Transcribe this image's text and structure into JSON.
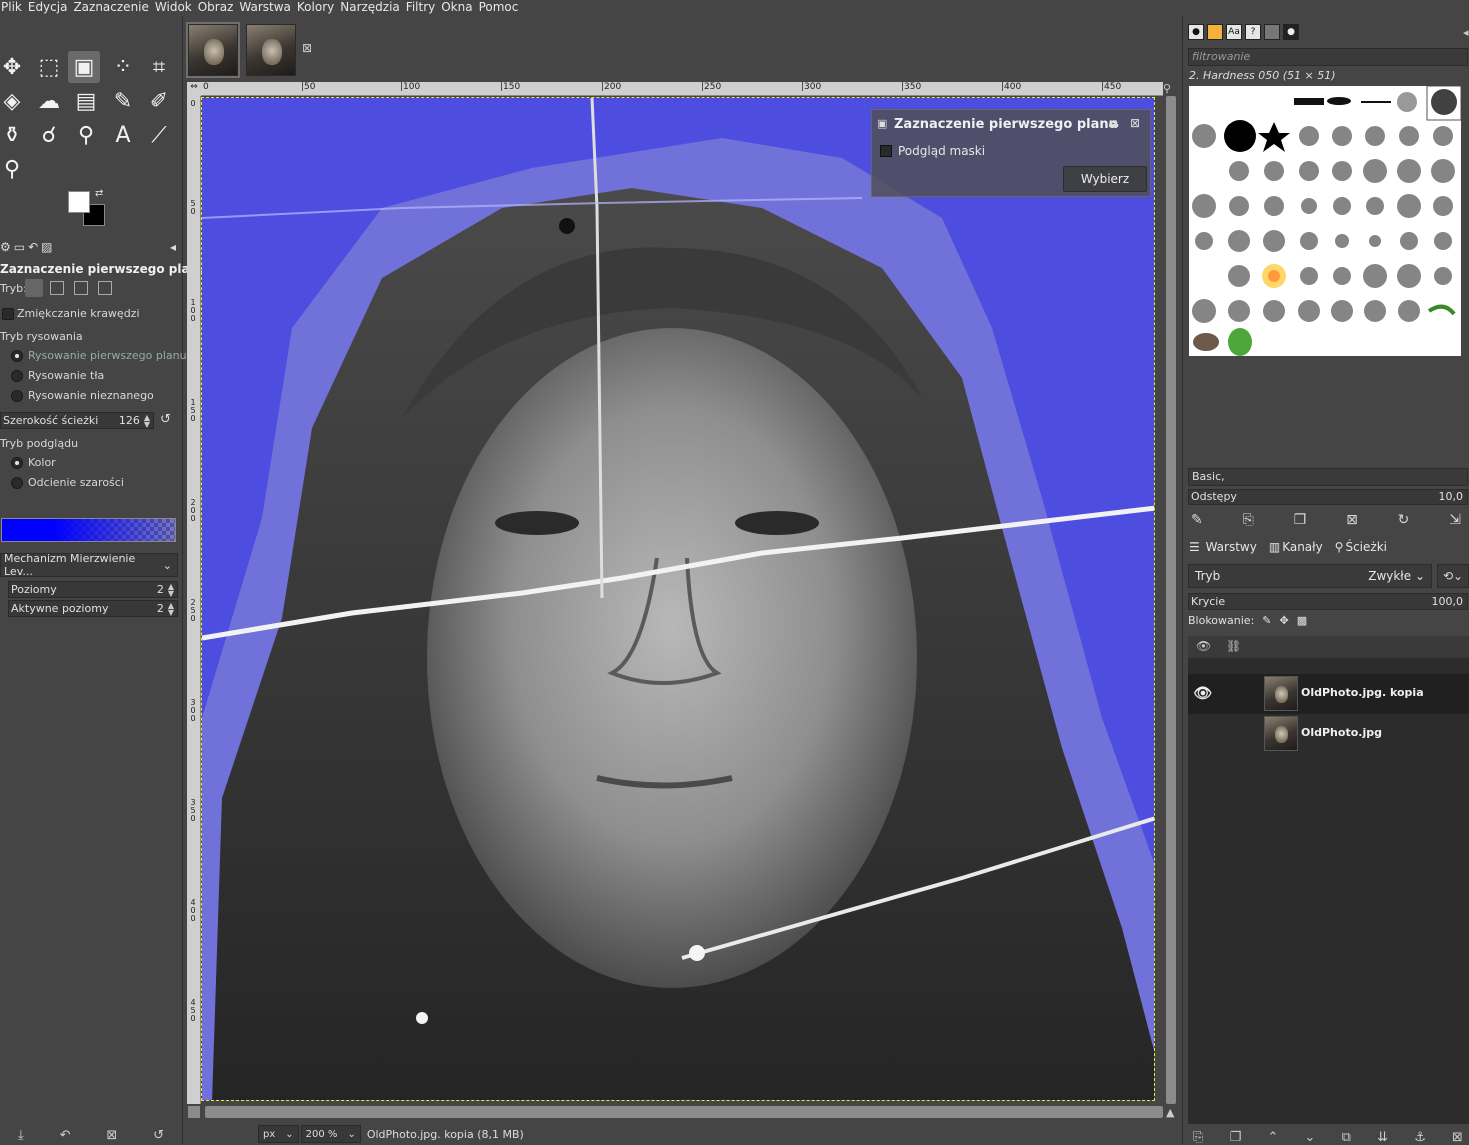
{
  "menubar": [
    "Plik",
    "Edycja",
    "Zaznaczenie",
    "Widok",
    "Obraz",
    "Warstwa",
    "Kolory",
    "Narzędzia",
    "Filtry",
    "Okna",
    "Pomoc"
  ],
  "tool_options": {
    "title": "Zaznaczenie pierwszego planu",
    "mode_label": "Tryb:",
    "antialias_label": "Zmiękczanie krawędzi",
    "draw_mode_label": "Tryb rysowania",
    "draw_modes": [
      "Rysowanie pierwszego planu",
      "Rysowanie tła",
      "Rysowanie nieznanego"
    ],
    "stroke_width_label": "Szerokość ścieżki",
    "stroke_width_value": "126",
    "preview_mode_label": "Tryb podglądu",
    "preview_modes": [
      "Kolor",
      "Odcienie szarości"
    ],
    "engine_label": "Mechanizm Mierzwienie Lev...",
    "levels_label": "Poziomy",
    "levels_value": "2",
    "active_levels_label": "Aktywne poziomy",
    "active_levels_value": "2"
  },
  "ruler_top": [
    "0",
    "|50",
    "|100",
    "|150",
    "|200",
    "|250",
    "|300",
    "|350",
    "|400",
    "|450"
  ],
  "ruler_left": [
    "0",
    "5\n0",
    "1\n0\n0",
    "1\n5\n0",
    "2\n0\n0",
    "2\n5\n0",
    "3\n0\n0",
    "3\n5\n0",
    "4\n0\n0",
    "4\n5\n0"
  ],
  "fsel_dialog": {
    "title": "Zaznaczenie pierwszego planu",
    "preview_mask_label": "Podgląd maski",
    "select_button": "Wybierz"
  },
  "statusbar": {
    "unit": "px",
    "zoom": "200 %",
    "info": "OldPhoto.jpg. kopia (8,1 MB)"
  },
  "brushes": {
    "filter_placeholder": "filtrowanie",
    "current_brush": "2. Hardness 050 (51 × 51)",
    "preset": "Basic,",
    "spacing_label": "Odstępy",
    "spacing_value": "10,0"
  },
  "layers": {
    "tabs": [
      "Warstwy",
      "Kanały",
      "Ścieżki"
    ],
    "mode_label": "Tryb",
    "mode_value": "Zwykłe",
    "opacity_label": "Krycie",
    "opacity_value": "100,0",
    "lock_label": "Blokowanie:",
    "items": [
      {
        "name": "OldPhoto.jpg. kopia",
        "visible": true,
        "selected": true
      },
      {
        "name": "OldPhoto.jpg",
        "visible": false,
        "selected": false
      }
    ]
  }
}
